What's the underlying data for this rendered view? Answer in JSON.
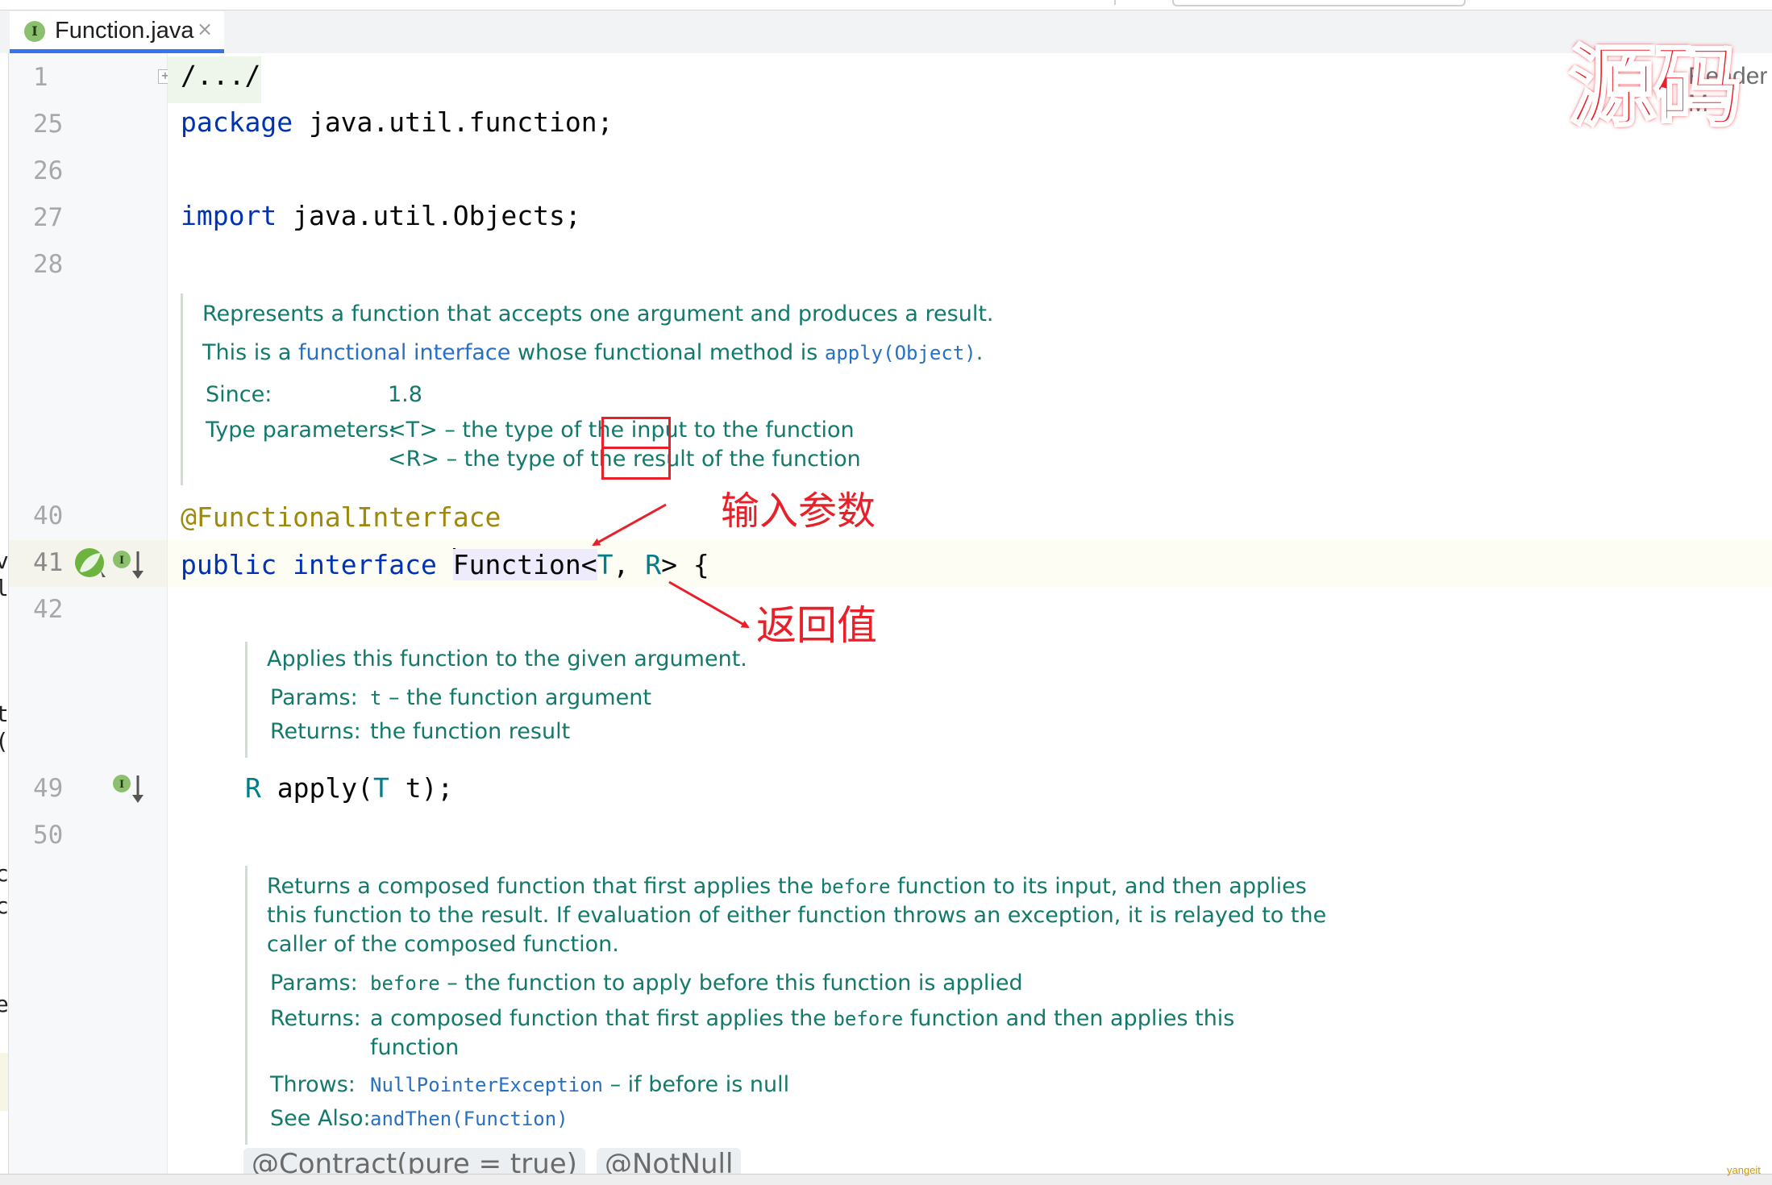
{
  "window": {
    "tab": {
      "label": "Function.java",
      "icon": "interface-icon",
      "close": "×"
    },
    "reader_mode_label": "Reader M",
    "brand_overlay": "源码"
  },
  "gutter": {
    "line_numbers": [
      "1",
      "25",
      "26",
      "27",
      "28",
      "40",
      "41",
      "42",
      "49",
      "50"
    ],
    "fold_marker": "+"
  },
  "code": {
    "line1": "/.../",
    "line25_kw": "package",
    "line25_rest": " java.util.function;",
    "line27_kw": "import",
    "line27_rest": " java.util.Objects;",
    "line40": "@FunctionalInterface",
    "line41_kw1": "public",
    "line41_kw2": "interface",
    "line41_name": "Function",
    "line41_lt": "<",
    "line41_T": "T",
    "line41_comma": ", ",
    "line41_R": "R",
    "line41_gt": "> {",
    "line49_R": "R",
    "line49_apply": " apply(",
    "line49_T": "T",
    "line49_rest": " t);"
  },
  "doc1": {
    "summary": "Represents a function that accepts one argument and produces a result.",
    "functional_prefix": "This is a ",
    "functional_link": "functional interface",
    "functional_mid": " whose functional method is ",
    "functional_code": "apply(Object)",
    "functional_end": ".",
    "since_label": "Since:",
    "since_value": "1.8",
    "type_params_label": "Type parameters:",
    "tparam_T_pre": "<T> – the type of the ",
    "tparam_T_word": "input",
    "tparam_T_post": " to the function",
    "tparam_R_pre": "<R> – the type of the ",
    "tparam_R_word": "result",
    "tparam_R_post": " of the function"
  },
  "doc2": {
    "summary": "Applies this function to the given argument.",
    "params_label": "Params:",
    "params_code": "t",
    "params_text": " – the function argument",
    "returns_label": "Returns:",
    "returns_text": "the function result"
  },
  "doc3": {
    "line1_a": "Returns a composed function that first applies the ",
    "line1_code": "before",
    "line1_b": " function to its input, and then applies",
    "line2": "this function to the result. If evaluation of either function throws an exception, it is relayed to the",
    "line3": "caller of the composed function.",
    "params_label": "Params:",
    "params_code": "before",
    "params_text": " – the function to apply before this function is applied",
    "returns_label": "Returns:",
    "returns_a": "a composed function that first applies the ",
    "returns_code": "before",
    "returns_b": " function and then applies this",
    "returns_c": "function",
    "throws_label": "Throws:",
    "throws_code": "NullPointerException",
    "throws_text": " – if before is null",
    "see_label": "See Also:",
    "see_code": "andThen(Function)"
  },
  "clipped_annotations": [
    "@Contract(pure = true)",
    "@NotNull"
  ],
  "annotations": {
    "input_label": "输入参数",
    "return_label": "返回值"
  },
  "watermark": "yangeit",
  "colors": {
    "keyword": "#0033b3",
    "annotation": "#9e880d",
    "type_param": "#007e8a",
    "doc_text": "#137a6b",
    "doc_link": "#2870c4",
    "callout_red": "#e8202a",
    "tab_underline": "#3574f0"
  }
}
